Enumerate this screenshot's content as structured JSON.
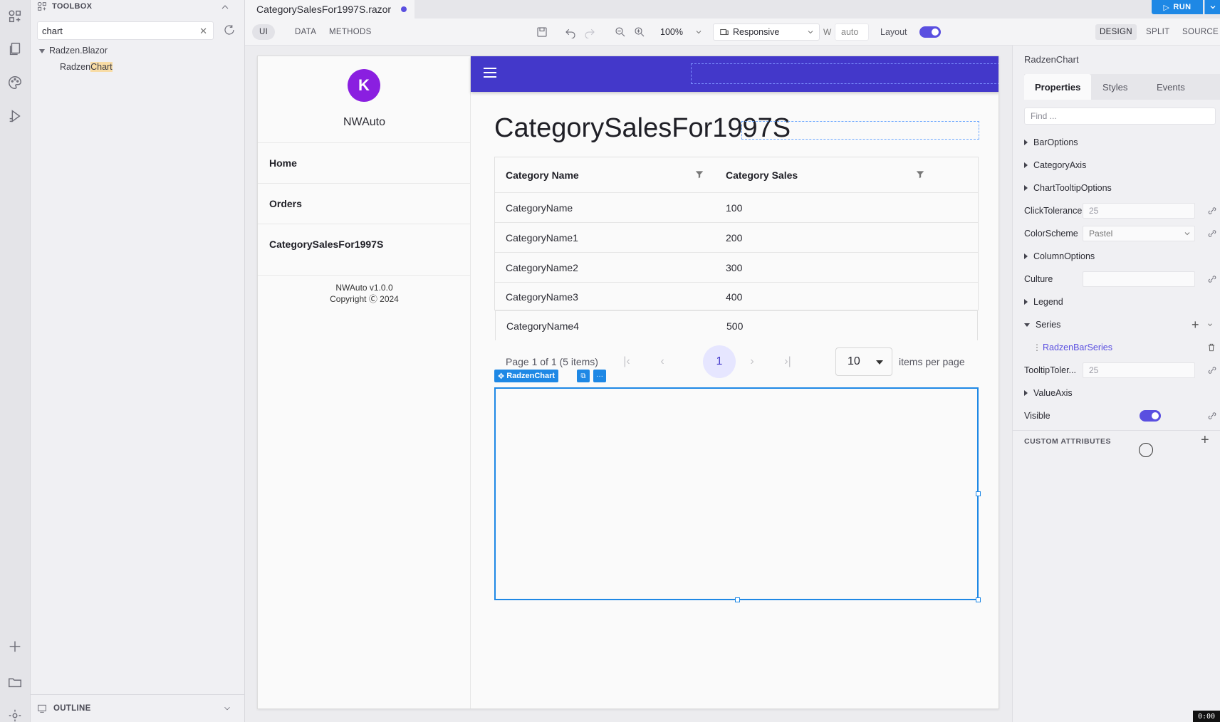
{
  "toolbox": {
    "header": "TOOLBOX",
    "search_value": "chart",
    "tree_root": "Radzen.Blazor",
    "tree_item_prefix": "Radzen",
    "tree_item_match": "Chart",
    "outline_label": "OUTLINE"
  },
  "editor": {
    "file_tab": "CategorySalesFor1997S.razor",
    "run_label": "RUN",
    "modes": [
      "UI",
      "DATA",
      "METHODS"
    ],
    "zoom": "100%",
    "device": "Responsive",
    "width_label": "W",
    "width_value": "auto",
    "layout_label": "Layout",
    "views": [
      "DESIGN",
      "SPLIT",
      "SOURCE"
    ]
  },
  "app": {
    "name": "NWAuto",
    "logo_letter": "K",
    "nav": [
      "Home",
      "Orders",
      "CategorySalesFor1997S"
    ],
    "version": "NWAuto v1.0.0",
    "copyright": "Copyright Ⓒ 2024",
    "page_title": "CategorySalesFor1997S",
    "grid": {
      "columns": [
        "Category Name",
        "Category Sales"
      ],
      "rows": [
        [
          "CategoryName",
          "100"
        ],
        [
          "CategoryName1",
          "200"
        ],
        [
          "CategoryName2",
          "300"
        ],
        [
          "CategoryName3",
          "400"
        ],
        [
          "CategoryName4",
          "500"
        ]
      ]
    },
    "pager": {
      "summary": "Page 1 of 1 (5 items)",
      "current_page": "1",
      "page_size": "10",
      "page_size_label": "items per page"
    },
    "selected_component": "RadzenChart",
    "selected_more": "···"
  },
  "properties": {
    "title": "RadzenChart",
    "tabs": [
      "Properties",
      "Styles",
      "Events"
    ],
    "find_placeholder": "Find ...",
    "items": {
      "bar_options": "BarOptions",
      "category_axis": "CategoryAxis",
      "chart_tooltip_options": "ChartTooltipOptions",
      "click_tolerance_label": "ClickTolerance",
      "click_tolerance_value": "25",
      "color_scheme_label": "ColorScheme",
      "color_scheme_value": "Pastel",
      "column_options": "ColumnOptions",
      "culture_label": "Culture",
      "legend": "Legend",
      "series": "Series",
      "series_item": "RadzenBarSeries",
      "tooltip_tolerance_label": "TooltipToler...",
      "tooltip_tolerance_value": "25",
      "value_axis": "ValueAxis",
      "visible_label": "Visible"
    },
    "custom_attributes": "CUSTOM ATTRIBUTES"
  },
  "recording_time": "0:00",
  "colors": {
    "accent": "#4338ca",
    "selection": "#1e88e5",
    "toggle": "#5a4fe0"
  }
}
